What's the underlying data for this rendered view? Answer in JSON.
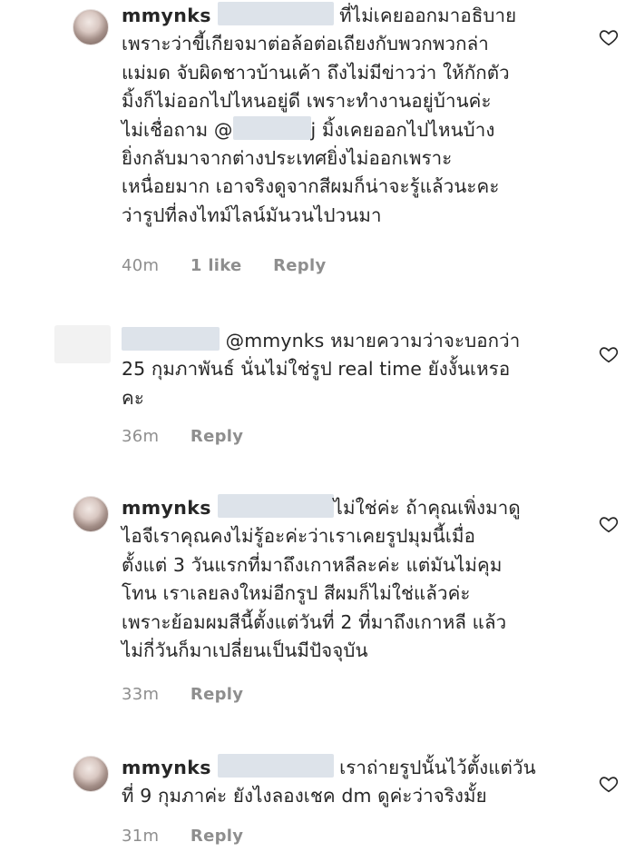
{
  "comments": [
    {
      "username": "mmynks",
      "lines": [
        "ที่ไม่เคยออกมาอธิบาย",
        "เพราะว่าขี้เกียจมาต่อล้อต่อเถียงกับพวกพวกล่า",
        "แม่มด จับผิดชาวบ้านเค้า ถึงไม่มีข่าวว่า ให้กักตัว",
        "มิ้งก็ไม่ออกไปไหนอยู่ดี เพราะทำงานอยู่บ้านค่ะ",
        "ไม่เชื่อถาม @",
        "j มิ้งเคยออกไปไหนบ้าง",
        "ยิ่งกลับมาจากต่างประเทศยิ่งไม่ออกเพราะ",
        "เหนื่อยมาก เอาจริงดูจากสีผมก็น่าจะรู้แล้วนะคะ",
        "ว่ารูปที่ลงไทม์ไลน์มันวนไปวนมา"
      ],
      "time": "40m",
      "likes": "1 like",
      "reply": "Reply"
    },
    {
      "mention": "@mmynks",
      "lines": [
        "หมายความว่าจะบอกว่า",
        "25 กุมภาพันธ์ นั่นไม่ใช่รูป real time ยังงั้นเหรอ",
        "คะ"
      ],
      "time": "36m",
      "reply": "Reply"
    },
    {
      "username": "mmynks",
      "lines": [
        "ไม่ใช่ค่ะ ถ้าคุณเพิ่งมาดู",
        "ไอจีเราคุณคงไม่รู้อะค่ะว่าเราเคยรูปมุมนี้เมื่อ",
        "ตั้งแต่ 3 วันแรกที่มาถึงเกาหลีละค่ะ แต่มันไม่คุม",
        "โทน เราเลยลงใหม่อีกรูป สีผมก็ไม่ใช่แล้วค่ะ",
        "เพราะย้อมผมสีนี้ตั้งแต่วันที่ 2 ที่มาถึงเกาหลี แล้ว",
        "ไม่กี่วันก็มาเปลี่ยนเป็นมีปัจจุบัน"
      ],
      "time": "33m",
      "reply": "Reply"
    },
    {
      "username": "mmynks",
      "lines": [
        "เราถ่ายรูปนั้นไว้ตั้งแต่วัน",
        "ที่ 9 กุมภาค่ะ ยังไงลองเชค dm ดูค่ะว่าจริงมั้ย"
      ],
      "time": "31m",
      "reply": "Reply"
    }
  ],
  "icons": {
    "like": "heart-outline-icon",
    "avatar": "profile-photo"
  },
  "colors": {
    "text": "#262626",
    "meta": "#8e8e8e",
    "redaction": "#dde3ea"
  }
}
